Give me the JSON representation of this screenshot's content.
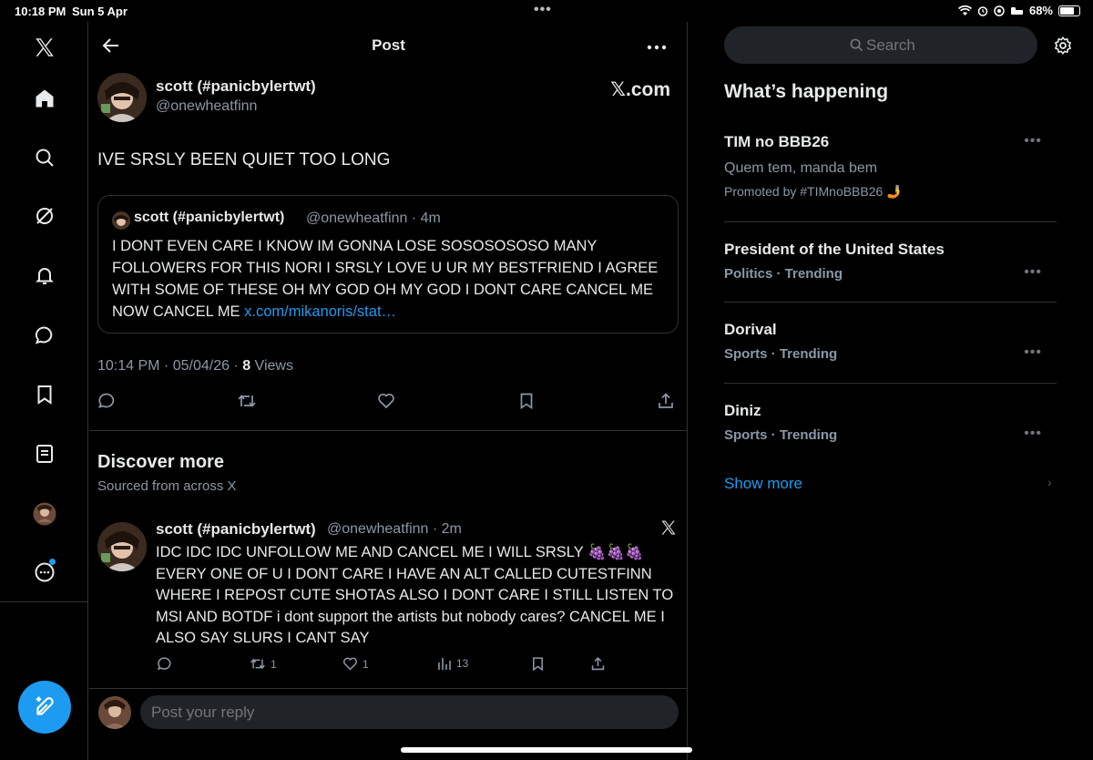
{
  "status_bar": {
    "time": "10:18 PM",
    "date": "Sun 5 Apr",
    "battery": "68%"
  },
  "header": {
    "title": "Post"
  },
  "post": {
    "author_name": "scott (#panicbylertwt)",
    "author_handle": "@onewheatfinn",
    "source_label": "𝕏.com",
    "text": "IVE SRSLY BEEN QUIET TOO LONG",
    "timestamp": "10:14 PM · 05/04/26 · ",
    "views_count": "8",
    "views_label": " Views"
  },
  "quote": {
    "author_name": "scott (#panicbylertwt)",
    "meta": "@onewheatfinn · 4m",
    "text": "I DONT EVEN CARE I KNOW IM GONNA LOSE SOSOSOSOSO MANY FOLLOWERS FOR THIS NORI I SRSLY LOVE U UR MY BESTFRIEND I AGREE WITH SOME OF THESE OH MY GOD OH MY GOD I DONT CARE CANCEL ME NOW CANCEL ME ",
    "link": "x.com/mikanoris/stat…"
  },
  "discover": {
    "title": "Discover more",
    "subtitle": "Sourced from across X"
  },
  "post2": {
    "author_name": "scott (#panicbylertwt)",
    "meta": "@onewheatfinn · 2m",
    "text": "IDC IDC IDC UNFOLLOW ME AND CANCEL ME I WILL SRSLY 🍇🍇🍇 EVERY ONE OF U I DONT CARE I HAVE AN ALT CALLED CUTESTFINN WHERE I REPOST CUTE SHOTAS ALSO I DONT CARE I STILL LISTEN TO MSI AND BOTDF i dont support the artists but nobody cares? CANCEL ME I ALSO SAY SLURS I CANT SAY",
    "reposts": "1",
    "likes": "1",
    "views": "13"
  },
  "reply": {
    "placeholder": "Post your reply"
  },
  "sidebar": {
    "search_placeholder": "Search",
    "whats_happening": "What’s happening",
    "trends": [
      {
        "title": "TIM no BBB26",
        "subtitle": "Quem tem, manda bem",
        "promoted": "Promoted by #TIMnoBBB26 🤳"
      },
      {
        "title": "President of the United States",
        "category": "Politics · Trending"
      },
      {
        "title": "Dorival",
        "category": "Sports · Trending"
      },
      {
        "title": "Diniz",
        "category": "Sports · Trending"
      }
    ],
    "show_more": "Show more"
  },
  "colors": {
    "accent": "#1d9bf0",
    "background": "#000000",
    "border": "#2f3336",
    "muted": "#8b98a5"
  }
}
